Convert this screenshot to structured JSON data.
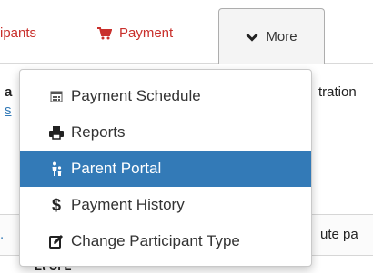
{
  "nav": {
    "participants_label": "ipants",
    "payment_label": "Payment",
    "more_label": "More"
  },
  "background": {
    "left_letter": "a",
    "left_link": "s",
    "right_word": "tration",
    "band_left_mark": ".",
    "band_right": "ute pa",
    "bottom_left": "Lt    Ui  L"
  },
  "menu": {
    "items": [
      {
        "label": "Payment Schedule",
        "icon": "calendar-icon"
      },
      {
        "label": "Reports",
        "icon": "printer-icon"
      },
      {
        "label": "Parent Portal",
        "icon": "family-icon"
      },
      {
        "label": "Payment History",
        "icon": "dollar-icon"
      },
      {
        "label": "Change Participant Type",
        "icon": "edit-icon"
      }
    ],
    "active_index": 2
  },
  "colors": {
    "link_red": "#c9302c",
    "active_blue": "#337ab7",
    "text_dark": "#333333"
  }
}
